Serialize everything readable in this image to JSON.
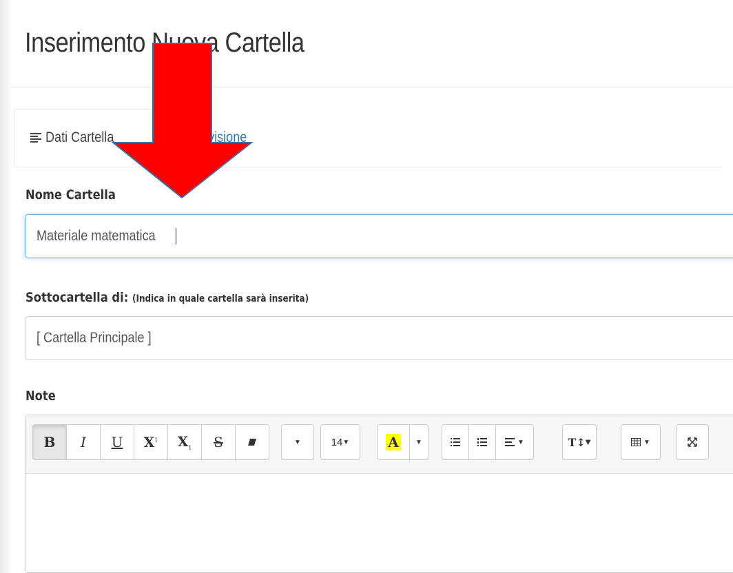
{
  "page": {
    "title": "Inserimento Nuova Cartella"
  },
  "tabs": [
    {
      "label": "Dati Cartella",
      "icon": "align-left-icon",
      "active": true
    },
    {
      "label": "ndivisione",
      "active": false
    }
  ],
  "form": {
    "nome": {
      "label": "Nome Cartella",
      "value": "Materiale matematica"
    },
    "sottocartella": {
      "label": "Sottocartella di:",
      "hint": "(Indica in quale cartella sarà inserita)",
      "value": "[ Cartella Principale ]"
    },
    "note": {
      "label": "Note"
    }
  },
  "toolbar": {
    "bold": "B",
    "italic": "I",
    "underline": "U",
    "superscript": "X",
    "subscript": "X",
    "strike": "S",
    "font_size": "14",
    "color": "A",
    "text_height": "T",
    "icons": [
      "bold-icon",
      "italic-icon",
      "underline-icon",
      "superscript-icon",
      "subscript-icon",
      "strikethrough-icon",
      "eraser-icon",
      "font-family-dropdown",
      "font-size-dropdown",
      "color-icon",
      "unordered-list-icon",
      "ordered-list-icon",
      "align-icon",
      "line-height-icon",
      "table-icon",
      "fullscreen-icon"
    ]
  },
  "colors": {
    "link": "#337ab7",
    "focus_border": "#66afe9",
    "arrow_fill": "#ff0000",
    "arrow_stroke": "#3a6ea5",
    "highlight": "#ffff00"
  }
}
